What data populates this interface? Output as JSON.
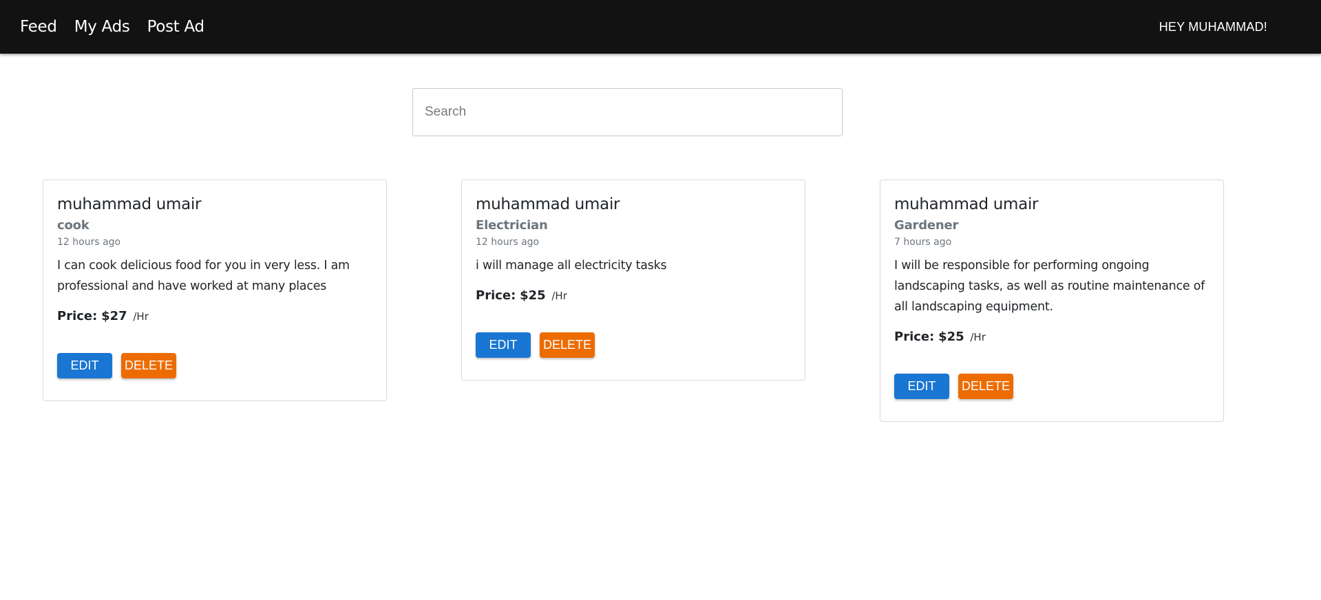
{
  "nav": {
    "links": [
      {
        "label": "Feed"
      },
      {
        "label": "My Ads"
      },
      {
        "label": "Post Ad"
      }
    ],
    "greeting": "HEY MUHAMMAD!"
  },
  "search": {
    "placeholder": "Search",
    "value": ""
  },
  "ads": [
    {
      "name": "muhammad umair",
      "category": "cook",
      "time": "12 hours ago",
      "description": "I can cook delicious food for you in very less. I am professional and have worked at many places",
      "price_label": "Price:",
      "price": "$27",
      "unit": "/Hr",
      "edit_label": "EDIT",
      "delete_label": "DELETE"
    },
    {
      "name": "muhammad umair",
      "category": "Electrician",
      "time": "12 hours ago",
      "description": "i will manage all electricity tasks",
      "price_label": "Price:",
      "price": "$25",
      "unit": "/Hr",
      "edit_label": "EDIT",
      "delete_label": "DELETE"
    },
    {
      "name": "muhammad umair",
      "category": "Gardener",
      "time": "7 hours ago",
      "description": "I will be responsible for performing ongoing landscaping tasks, as well as routine maintenance of all landscaping equipment.",
      "price_label": "Price:",
      "price": "$25",
      "unit": "/Hr",
      "edit_label": "EDIT",
      "delete_label": "DELETE"
    }
  ],
  "colors": {
    "navbar": "#121212",
    "edit_button": "#1976d2",
    "delete_button": "#ed6c02",
    "muted_text": "#6c757d"
  }
}
